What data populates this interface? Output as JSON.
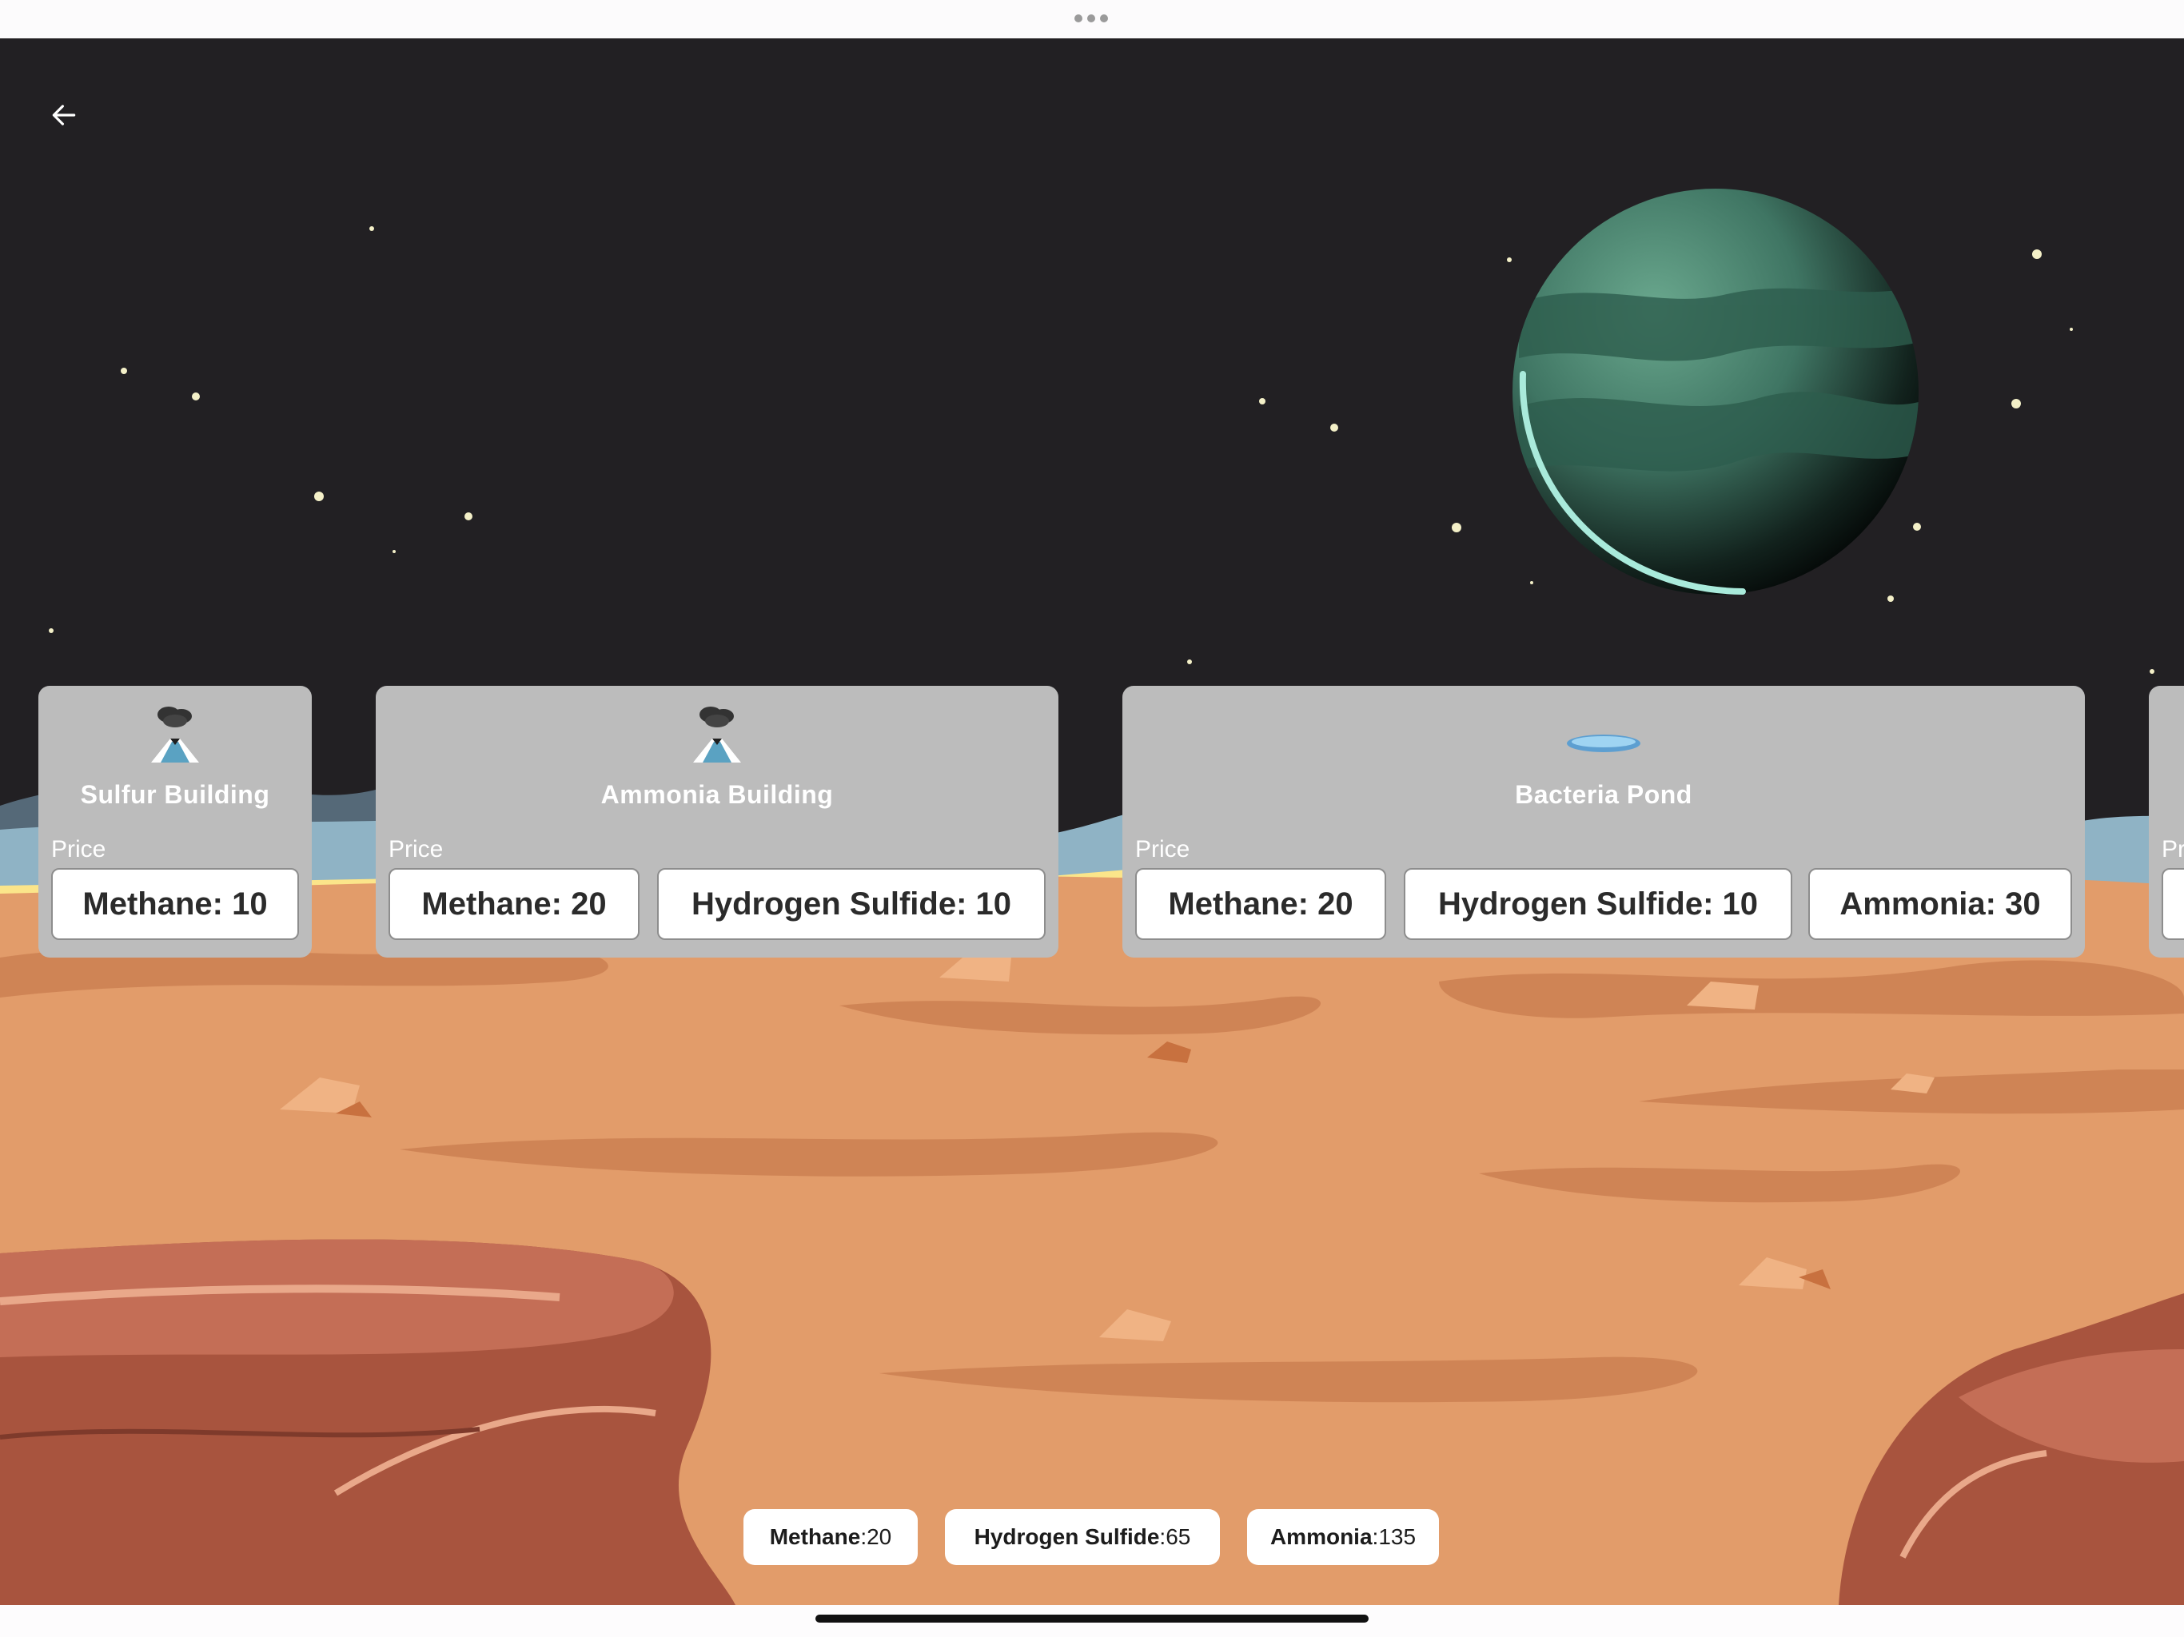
{
  "nav": {
    "back_icon": "arrow-left-icon"
  },
  "buildings": [
    {
      "name": "Sulfur Building",
      "icon": "volcano-icon",
      "price_label": "Price",
      "prices": [
        "Methane: 10"
      ]
    },
    {
      "name": "Ammonia Building",
      "icon": "volcano-icon",
      "price_label": "Price",
      "prices": [
        "Methane: 20",
        "Hydrogen Sulfide: 10"
      ]
    },
    {
      "name": "Bacteria Pond",
      "icon": "pond-icon",
      "price_label": "Price",
      "prices": [
        "Methane: 20",
        "Hydrogen Sulfide: 10",
        "Ammonia: 30"
      ]
    },
    {
      "name": "",
      "icon": "",
      "price_label": "Pr",
      "prices": [
        ""
      ]
    }
  ],
  "resources": [
    {
      "name": "Methane",
      "sep": " : ",
      "value": "20"
    },
    {
      "name": "Hydrogen Sulfide",
      "sep": " : ",
      "value": "65"
    },
    {
      "name": "Ammonia",
      "sep": " : ",
      "value": "135"
    }
  ],
  "colors": {
    "sky": "#222023",
    "planet": "#4d8a74",
    "ground": "#e29c6a",
    "card": "#bcbcbc"
  }
}
